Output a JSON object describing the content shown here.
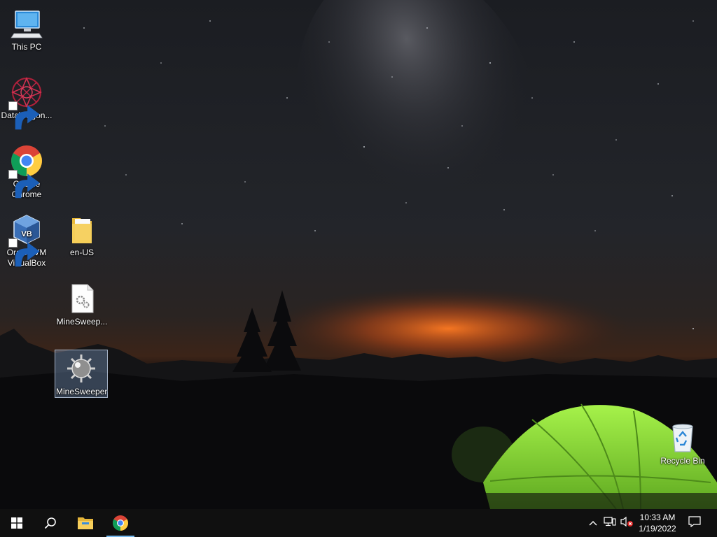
{
  "desktop": {
    "icons": [
      {
        "label": "This PC",
        "icon": "computer-icon"
      },
      {
        "label": "DataWagon...",
        "icon": "datawagon-icon"
      },
      {
        "label": "Google Chrome",
        "icon": "chrome-icon"
      },
      {
        "label": "Oracle VM VirtualBox",
        "icon": "virtualbox-icon"
      },
      {
        "label": "en-US",
        "icon": "folder-icon"
      },
      {
        "label": "MineSweep...",
        "icon": "config-file-icon"
      },
      {
        "label": "MineSweeper",
        "icon": "minesweeper-icon",
        "selected": true
      },
      {
        "label": "Recycle Bin",
        "icon": "recycle-bin-icon"
      }
    ]
  },
  "taskbar": {
    "start": "windows-start-icon",
    "search": "search-icon",
    "pinned": [
      {
        "name": "file-explorer",
        "icon": "folder-icon"
      },
      {
        "name": "chrome",
        "icon": "chrome-icon",
        "active": true
      }
    ],
    "tray": {
      "icons": [
        "chevron-up-icon",
        "network-icon",
        "volume-muted-icon"
      ],
      "time": "10:33 AM",
      "date": "1/19/2022",
      "notification": "action-center-icon"
    }
  },
  "colors": {
    "taskbar": "#101010",
    "tent": "#8fe23a",
    "horizon_glow": "#e2641c",
    "selection": "#7896be"
  }
}
